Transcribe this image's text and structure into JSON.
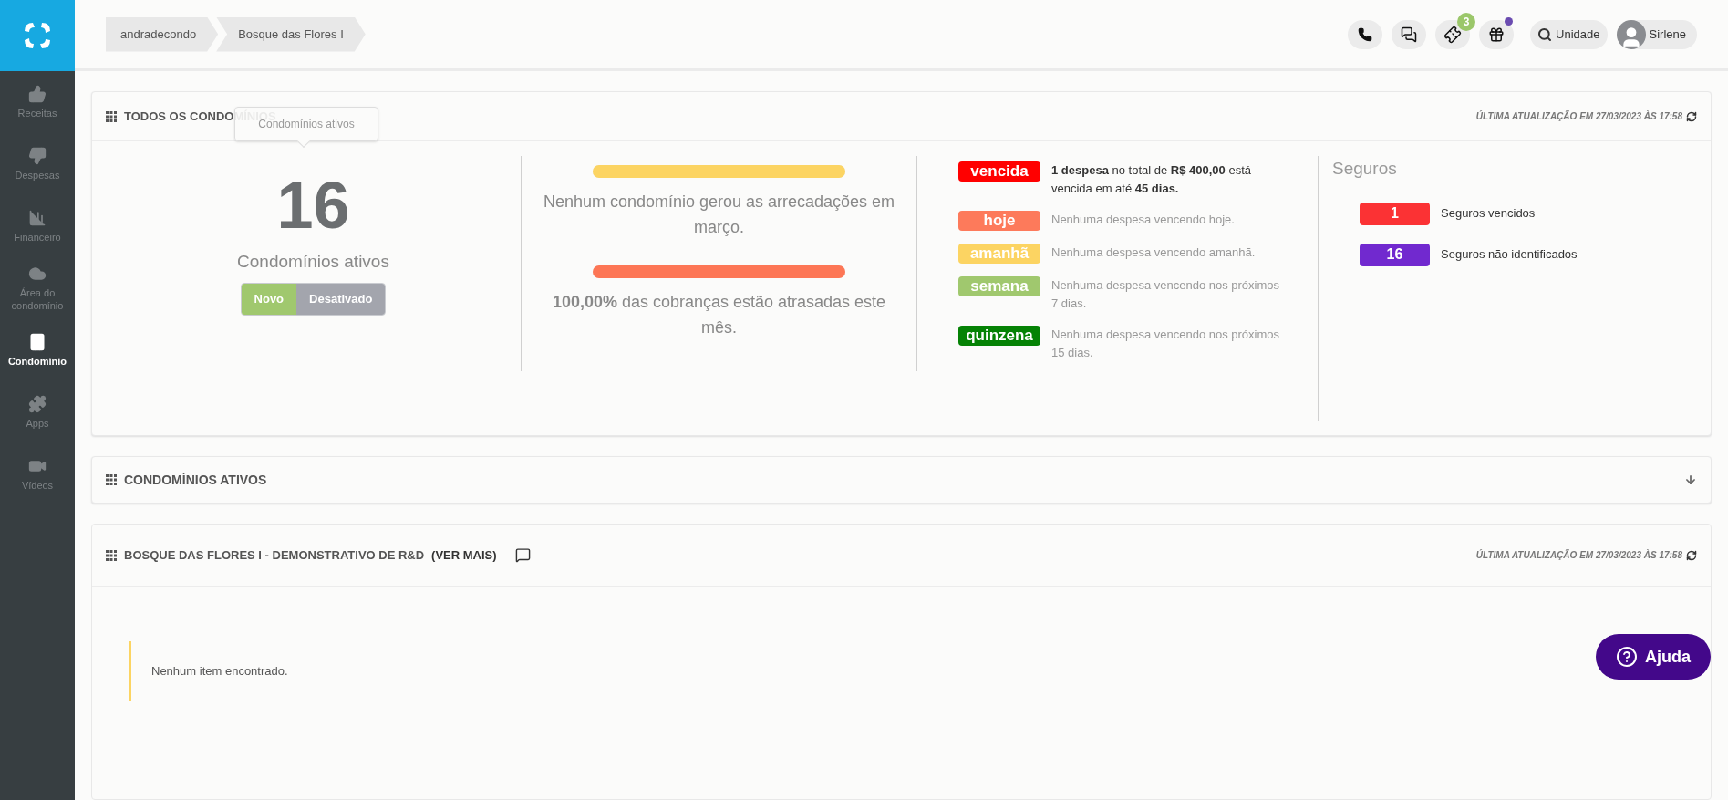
{
  "sidebar": {
    "items": [
      {
        "label": "Receitas",
        "selected": false
      },
      {
        "label": "Despesas",
        "selected": false
      },
      {
        "label": "Financeiro",
        "selected": false
      },
      {
        "label": "Área do condomínio",
        "selected": false
      },
      {
        "label": "Condomínio",
        "selected": true
      },
      {
        "label": "Apps",
        "selected": false
      },
      {
        "label": "Vídeos",
        "selected": false
      }
    ]
  },
  "breadcrumb": [
    "andradecondo",
    "Bosque das Flores I"
  ],
  "header": {
    "ticket_badge": "3",
    "gift_dot": true,
    "search_label": "Unidade",
    "user_name": "Sirlene"
  },
  "summary_card": {
    "title": "TODOS OS CONDOMÍNIOS",
    "tooltip": "Condomínios ativos",
    "updated": "ÚLTIMA ATUALIZAÇÃO EM 27/03/2023 ÀS 17:58",
    "count": "16",
    "count_label": "Condomínios ativos",
    "toggle": [
      {
        "label": "Novo",
        "selected": true
      },
      {
        "label": "Desativado",
        "selected": false
      }
    ],
    "progress": [
      {
        "color": "#fcd462",
        "level": 1,
        "text": "Nenhum condomínio gerou as arrecadações em março."
      },
      {
        "color": "#fd7655",
        "level": 1,
        "text": "**100,00%** das cobranças estão atrasadas este mês."
      }
    ],
    "alerts": [
      {
        "badge": "vencida",
        "color": "#ff0000",
        "active": true,
        "text": "**1 despesa** no total de **R$ 400,00** está vencida em até **45 dias.**"
      },
      {
        "badge": "hoje",
        "color": "#fd7a5b",
        "active": false,
        "text": "Nenhuma despesa vencendo hoje."
      },
      {
        "badge": "amanhã",
        "color": "#fcd462",
        "active": false,
        "text": "Nenhuma despesa vencendo amanhã."
      },
      {
        "badge": "semana",
        "color": "#a0c86e",
        "active": false,
        "text": "Nenhuma despesa vencendo nos próximos 7 dias."
      },
      {
        "badge": "quinzena",
        "color": "#058205",
        "active": false,
        "text": "Nenhuma despesa vencendo nos próximos 15 dias."
      }
    ],
    "insurance": {
      "title": "Seguros",
      "items": [
        {
          "count": "1",
          "color": "#fb3234",
          "label": "Seguros vencidos"
        },
        {
          "count": "16",
          "color": "#7129cf",
          "label": "Seguros não identificados"
        }
      ]
    }
  },
  "active_card": {
    "title": "CONDOMÍNIOS ATIVOS"
  },
  "report_card": {
    "title": "BOSQUE DAS FLORES I - DEMONSTRATIVO DE R&D",
    "link": "(VER MAIS)",
    "updated": "ÚLTIMA ATUALIZAÇÃO EM 27/03/2023 ÀS 17:58",
    "empty": "Nenhum item encontrado."
  },
  "help_button": "Ajuda"
}
